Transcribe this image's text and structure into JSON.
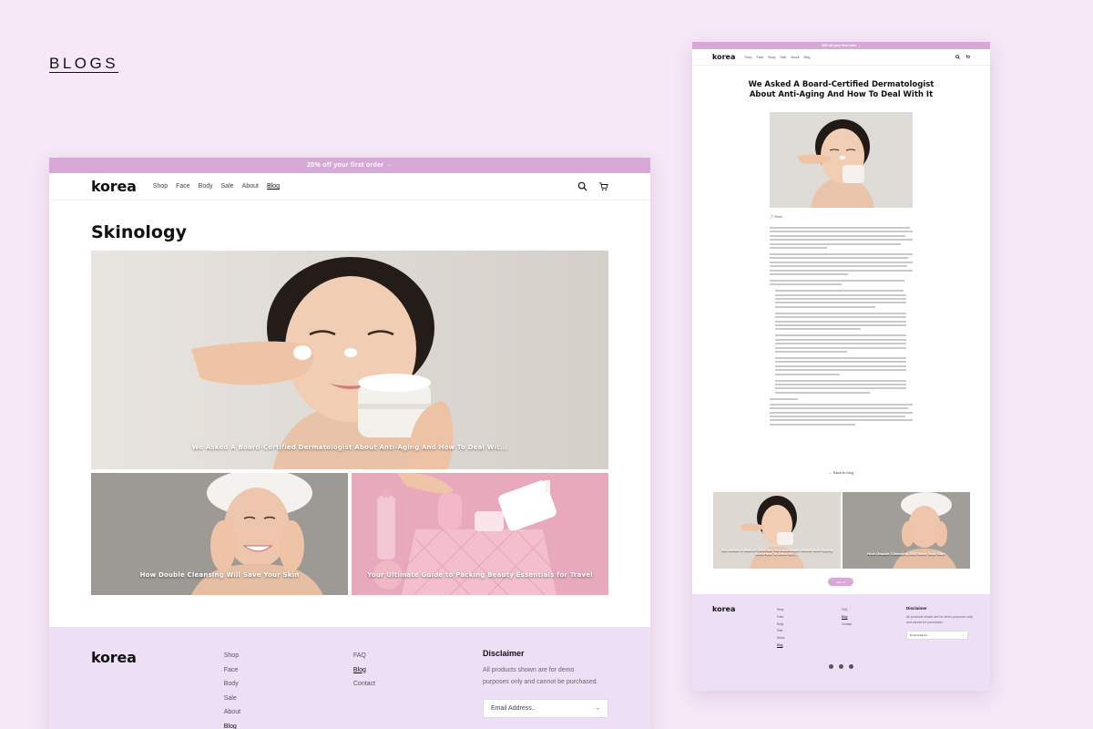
{
  "section_label": "BLOGS",
  "site": {
    "logo": "korea",
    "promo": "20% off your first order →",
    "nav": [
      "Shop",
      "Face",
      "Body",
      "Sale",
      "About",
      "Blog"
    ],
    "active_nav": "Blog"
  },
  "blog_page": {
    "title": "Skinology",
    "featured_title": "We Asked A Board-Certified Dermatologist About Anti-Aging And How To Deal Wit...",
    "cards": [
      {
        "title": "How Double Cleansing Will Save Your Skin"
      },
      {
        "title": "Your Ultimate Guide to Packing Beauty Essentials for Travel"
      }
    ]
  },
  "footer": {
    "col1": [
      "Shop",
      "Face",
      "Body",
      "Sale",
      "About",
      "Blog"
    ],
    "col2": [
      "FAQ",
      "Blog",
      "Contact"
    ],
    "disclaimer_title": "Disclaimer",
    "disclaimer_text": "All products shown are for demo purposes only and cannot be purchased.",
    "email_placeholder": "Email Address..",
    "email_arrow": "→"
  },
  "article_page": {
    "title": "We Asked A Board-Certified Dermatologist About Anti-Aging And How To Deal With It",
    "share": "Share",
    "back": "← Back to blog",
    "related": [
      {
        "title": "We Asked A Board-Certified Dermatologist About Anti-Aging And How To Deal Wit..."
      },
      {
        "title": "How Double Cleansing Will Save Your Skin"
      }
    ],
    "view_all": "View all"
  },
  "colors": {
    "page_bg": "#f6e8f7",
    "accent": "#d8a9d8",
    "footer_bg": "#ede0f6"
  }
}
